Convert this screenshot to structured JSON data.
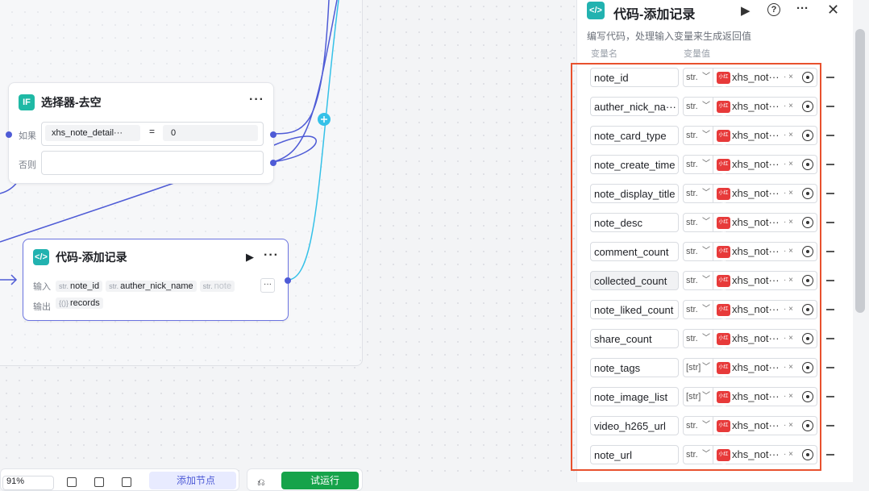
{
  "canvas": {
    "node_if": {
      "title": "选择器-去空",
      "icon": "IF",
      "if_label": "如果",
      "else_label": "否则",
      "condition_var": "xhs_note_detail···",
      "operator": "=",
      "condition_value": "0"
    },
    "node_code": {
      "title": "代码-添加记录",
      "input_label": "输入",
      "output_label": "输出",
      "inputs": [
        {
          "type": "str.",
          "name": "note_id"
        },
        {
          "type": "str.",
          "name": "auther_nick_name"
        },
        {
          "type": "str.",
          "name": "note"
        }
      ],
      "output_type": "{()}",
      "output_name": "records"
    },
    "toolbar": {
      "zoom": "91%",
      "add_node_label": "添加节点",
      "trial_run_label": "试运行"
    }
  },
  "panel": {
    "title": "代码-添加记录",
    "description": "编写代码，处理输入变量来生成返回值",
    "col_name": "变量名",
    "col_value": "变量值",
    "rows": [
      {
        "name": "note_id",
        "type": "str.",
        "value": "xhs_not···"
      },
      {
        "name": "auther_nick_na···",
        "type": "str.",
        "value": "xhs_not···"
      },
      {
        "name": "note_card_type",
        "type": "str.",
        "value": "xhs_not···"
      },
      {
        "name": "note_create_time",
        "type": "str.",
        "value": "xhs_not···"
      },
      {
        "name": "note_display_title",
        "type": "str.",
        "value": "xhs_not···"
      },
      {
        "name": "note_desc",
        "type": "str.",
        "value": "xhs_not···"
      },
      {
        "name": "comment_count",
        "type": "str.",
        "value": "xhs_not···"
      },
      {
        "name": "collected_count",
        "type": "str.",
        "value": "xhs_not···"
      },
      {
        "name": "note_liked_count",
        "type": "str.",
        "value": "xhs_not···"
      },
      {
        "name": "share_count",
        "type": "str.",
        "value": "xhs_not···"
      },
      {
        "name": "note_tags",
        "type": "[str]",
        "value": "xhs_not···"
      },
      {
        "name": "note_image_list",
        "type": "[str]",
        "value": "xhs_not···"
      },
      {
        "name": "video_h265_url",
        "type": "str.",
        "value": "xhs_not···"
      },
      {
        "name": "note_url",
        "type": "str.",
        "value": "xhs_not···"
      }
    ],
    "badge_text": "小红书",
    "clear_symbol": "×"
  },
  "colors": {
    "accent": "#22b2b0",
    "edge": "#4e5bd6",
    "highlight": "#e8512e",
    "run_button": "#16a34a"
  }
}
